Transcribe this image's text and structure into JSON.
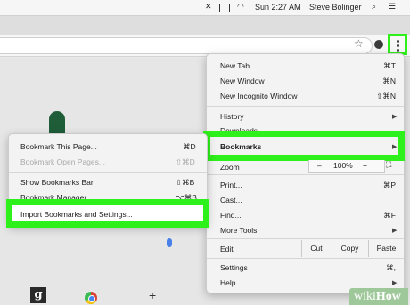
{
  "menubar": {
    "time": "Sun 2:27 AM",
    "user": "Steve Bolinger"
  },
  "main_menu": {
    "items": [
      {
        "label": "New Tab",
        "shortcut": "⌘T"
      },
      {
        "label": "New Window",
        "shortcut": "⌘N"
      },
      {
        "label": "New Incognito Window",
        "shortcut": "⇧⌘N"
      },
      {
        "label": "History"
      },
      {
        "label": "Downloads",
        "shortcut": "⌥⌘L"
      },
      {
        "label": "Bookmarks"
      },
      {
        "label": "Zoom"
      },
      {
        "label": "Print...",
        "shortcut": "⌘P"
      },
      {
        "label": "Cast..."
      },
      {
        "label": "Find...",
        "shortcut": "⌘F"
      },
      {
        "label": "More Tools"
      },
      {
        "label": "Edit"
      },
      {
        "label": "Settings",
        "shortcut": "⌘,"
      },
      {
        "label": "Help"
      }
    ],
    "zoom": {
      "minus": "–",
      "value": "100%",
      "plus": "+"
    },
    "edit": {
      "cut": "Cut",
      "copy": "Copy",
      "paste": "Paste"
    }
  },
  "bookmarks_submenu": {
    "items": [
      {
        "label": "Bookmark This Page...",
        "shortcut": "⌘D"
      },
      {
        "label": "Bookmark Open Pages...",
        "shortcut": "⇧⌘D"
      },
      {
        "label": "Show Bookmarks Bar",
        "shortcut": "⇧⌘B"
      },
      {
        "label": "Bookmark Manager",
        "shortcut": "⌥⌘B"
      },
      {
        "label": "Import Bookmarks and Settings..."
      }
    ]
  },
  "shortcuts": {
    "g_label": "g",
    "add_label": "+"
  },
  "watermark": {
    "wiki": "wiki",
    "how": "How"
  },
  "colors": {
    "highlight": "#2ef01a",
    "menu_bg": "#f3f3f3"
  }
}
